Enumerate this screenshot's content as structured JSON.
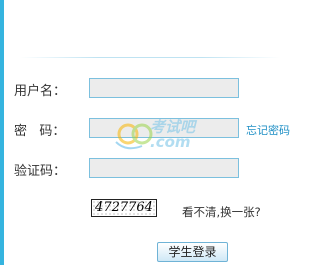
{
  "form": {
    "username_label": "用户名：",
    "password_label": "密   码：",
    "forgot_label": "忘记密码",
    "captcha_label": "验证码：",
    "captcha_code": "4727764",
    "refresh_label": "看不清,换一张?",
    "submit_label": "学生登录",
    "username_value": "",
    "password_value": "",
    "captcha_value": ""
  },
  "watermark": {
    "brand": "考试吧",
    "domain": ".com"
  },
  "colors": {
    "accent": "#35b4df",
    "input_border": "#7cc0de",
    "input_bg": "#ececec",
    "link": "#1f8fc5"
  }
}
